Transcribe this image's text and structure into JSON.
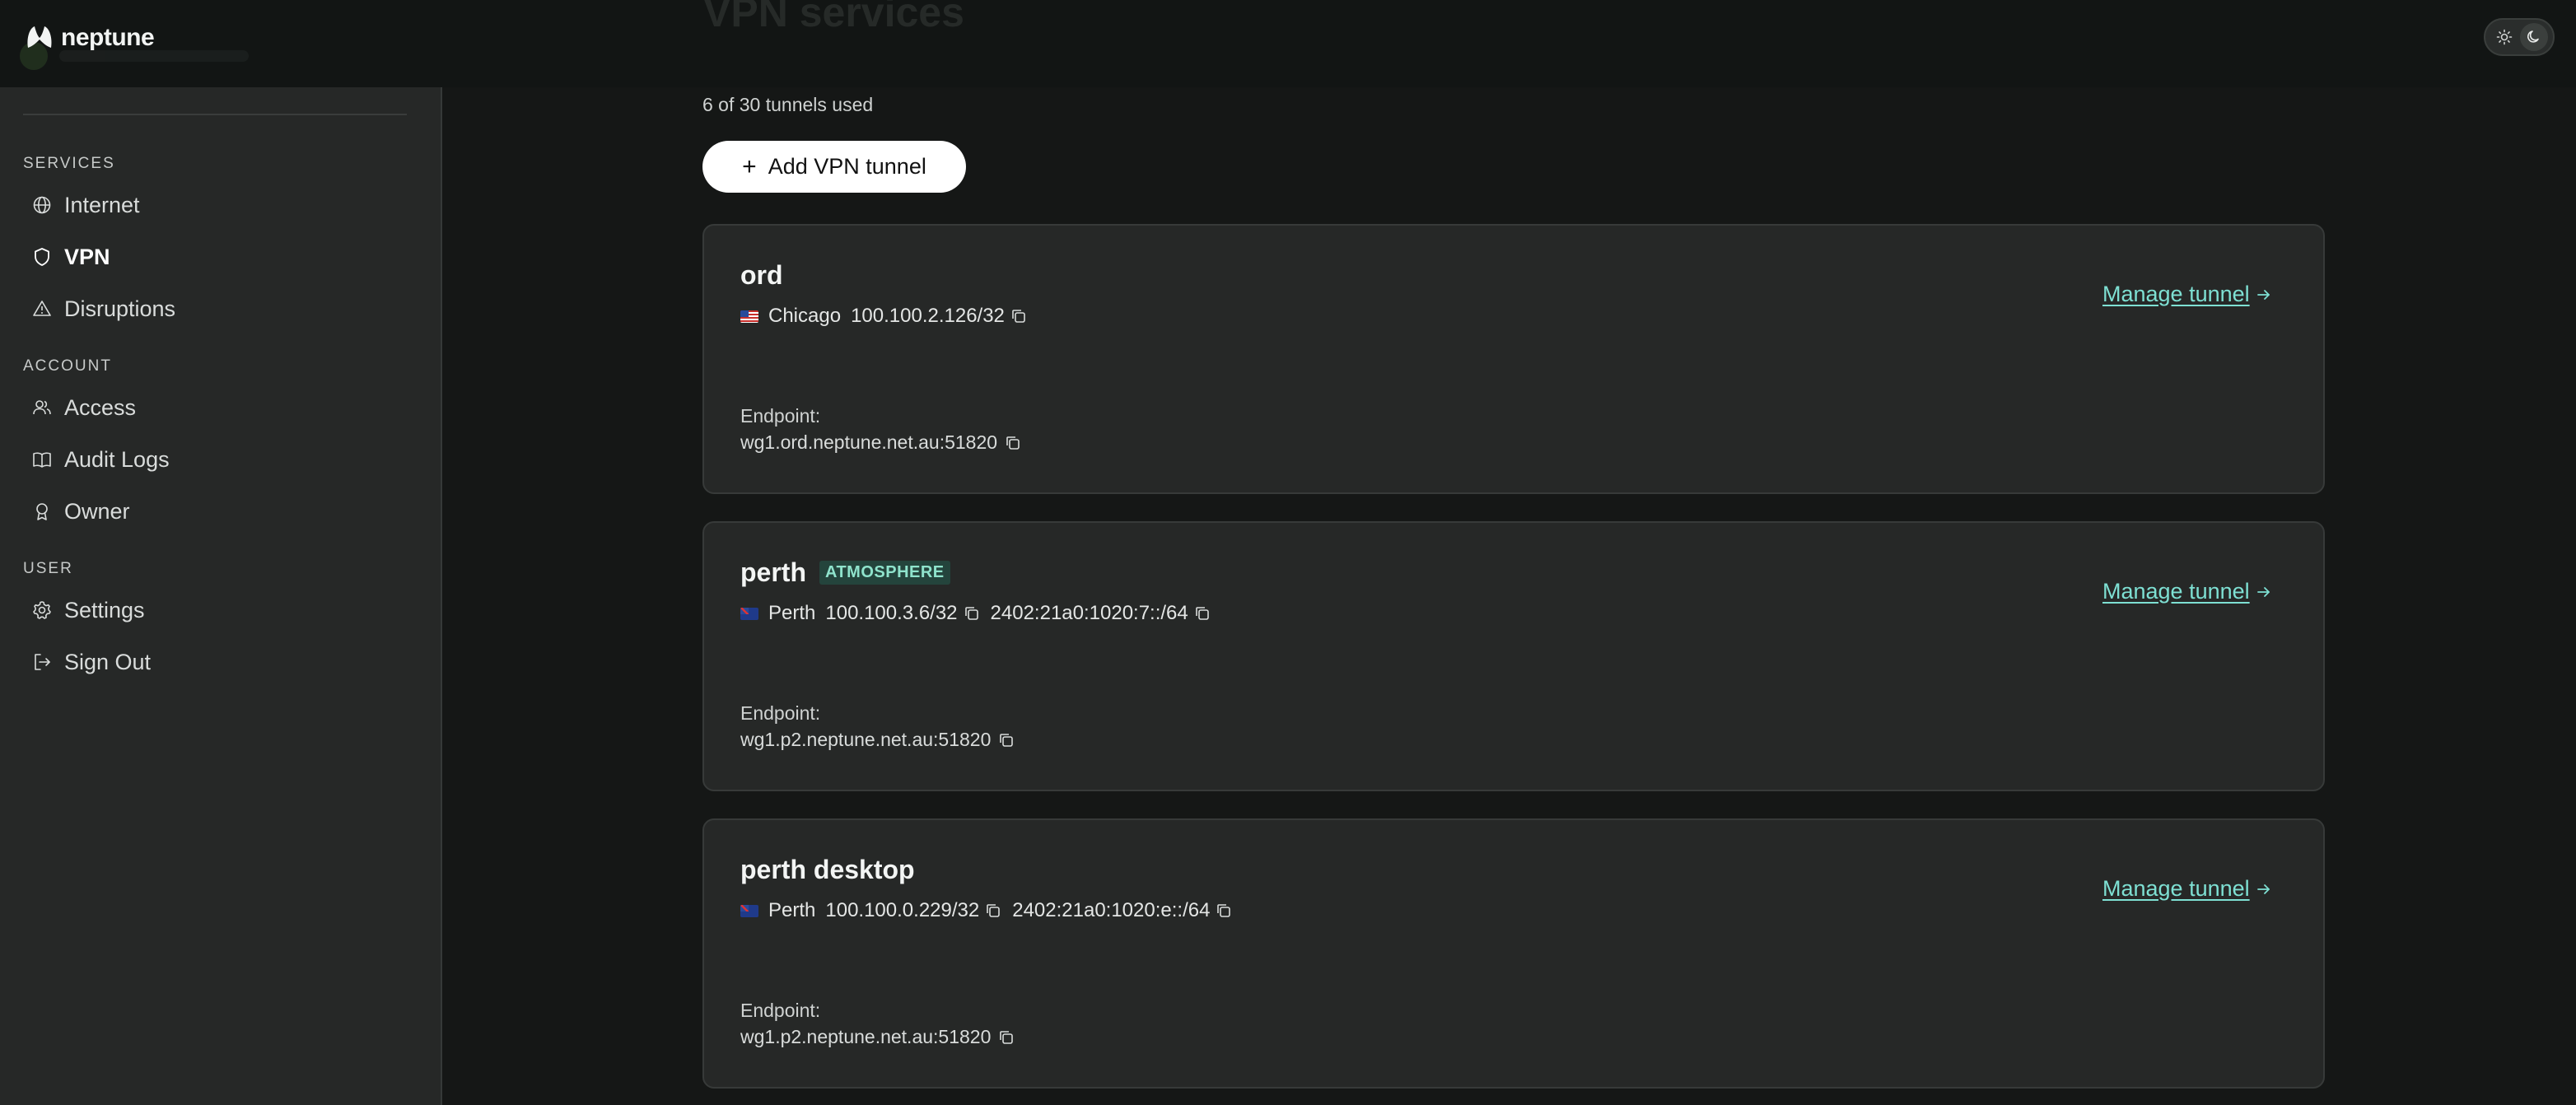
{
  "app": {
    "name": "neptune"
  },
  "header": {
    "page_title": "VPN services",
    "theme": {
      "light_icon": "sun-icon",
      "dark_icon": "moon-icon",
      "active": "dark"
    }
  },
  "sidebar": {
    "sections": [
      {
        "label": "SERVICES",
        "items": [
          {
            "label": "Internet",
            "icon": "globe-icon"
          },
          {
            "label": "VPN",
            "icon": "shield-icon",
            "active": true
          },
          {
            "label": "Disruptions",
            "icon": "warning-icon"
          }
        ]
      },
      {
        "label": "ACCOUNT",
        "items": [
          {
            "label": "Access",
            "icon": "users-icon"
          },
          {
            "label": "Audit Logs",
            "icon": "book-icon"
          },
          {
            "label": "Owner",
            "icon": "award-icon"
          }
        ]
      },
      {
        "label": "USER",
        "items": [
          {
            "label": "Settings",
            "icon": "gear-icon"
          },
          {
            "label": "Sign Out",
            "icon": "sign-out-icon"
          }
        ]
      }
    ]
  },
  "main": {
    "usage_text": "6 of 30 tunnels used",
    "add_button_label": "Add VPN tunnel",
    "tunnels": [
      {
        "name": "ord",
        "badge": "",
        "flag": "us",
        "city": "Chicago",
        "ipv4": "100.100.2.126/32",
        "ipv6": "",
        "endpoint_label": "Endpoint:",
        "endpoint": "wg1.ord.neptune.net.au:51820",
        "manage_label": "Manage tunnel"
      },
      {
        "name": "perth",
        "badge": "ATMOSPHERE",
        "flag": "au",
        "city": "Perth",
        "ipv4": "100.100.3.6/32",
        "ipv6": "2402:21a0:1020:7::/64",
        "endpoint_label": "Endpoint:",
        "endpoint": "wg1.p2.neptune.net.au:51820",
        "manage_label": "Manage tunnel"
      },
      {
        "name": "perth desktop",
        "badge": "",
        "flag": "au",
        "city": "Perth",
        "ipv4": "100.100.0.229/32",
        "ipv6": "2402:21a0:1020:e::/64",
        "endpoint_label": "Endpoint:",
        "endpoint": "wg1.p2.neptune.net.au:51820",
        "manage_label": "Manage tunnel"
      }
    ]
  },
  "colors": {
    "accent_link": "#7ee0d3",
    "badge_bg": "#24443c",
    "badge_fg": "#8fe3cc",
    "card_bg": "#262827"
  }
}
